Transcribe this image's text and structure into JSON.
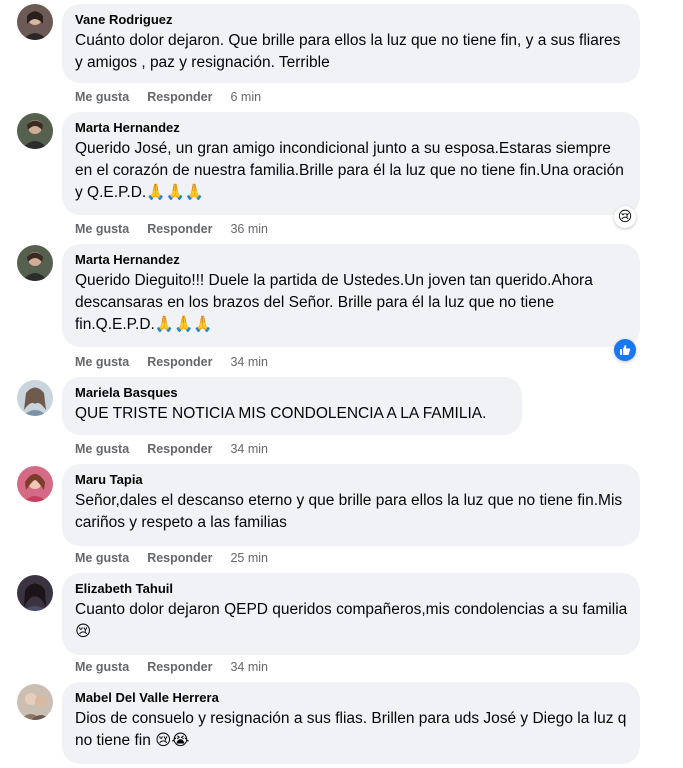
{
  "comments": [
    {
      "author": "Vane Rodriguez",
      "text": "Cuánto dolor dejaron. Que brille para ellos la luz que no tiene fin, y a sus fliares y amigos , paz y resignación. Terrible",
      "like": "Me gusta",
      "reply": "Responder",
      "time": "6 min",
      "avatar_color": "#4a3b3a"
    },
    {
      "author": "Marta Hernandez",
      "text": "Querido José, un gran amigo incondicional junto a su esposa.Estaras siempre en el corazón de nuestra familia.Brille para él la luz que no tiene fin.Una oración y Q.E.P.D.🙏🙏🙏",
      "like": "Me gusta",
      "reply": "Responder",
      "time": "36 min",
      "avatar_color": "#3d4a3f",
      "reaction_icon": "sad-reaction-icon",
      "reaction_glyph": "😢"
    },
    {
      "author": "Marta Hernandez",
      "text": "Querido Dieguito!!! Duele la partida de Ustedes.Un joven tan querido.Ahora descansaras en los brazos del Señor. Brille para él la luz que no tiene fin.Q.E.P.D.🙏🙏🙏",
      "like": "Me gusta",
      "reply": "Responder",
      "time": "34 min",
      "avatar_color": "#3d4a3f",
      "reaction_icon": "like-reaction-icon",
      "reaction_glyph": "👍"
    },
    {
      "author": "Mariela Basques",
      "text": "QUE TRISTE NOTICIA MIS CONDOLENCIA A LA FAMILIA.",
      "like": "Me gusta",
      "reply": "Responder",
      "time": "34 min",
      "avatar_color": "#a9b8c4"
    },
    {
      "author": "Maru Tapia",
      "text": "Señor,dales el descanso eterno y que brille para ellos la luz que no tiene fin.Mis cariños y respeto a las familias",
      "like": "Me gusta",
      "reply": "Responder",
      "time": "25 min",
      "avatar_color": "#c2536b"
    },
    {
      "author": "Elizabeth Tahuil",
      "text": "Cuanto dolor dejaron QEPD queridos compañeros,mis condolencias a su familia 😢",
      "like": "Me gusta",
      "reply": "Responder",
      "time": "34 min",
      "avatar_color": "#2e2a35"
    },
    {
      "author": "Mabel Del Valle Herrera",
      "text": "Dios de consuelo y resignación a sus flias. Brillen para uds José y Diego la luz q no tiene fin 😢😭",
      "like": "Me gusta",
      "reply": "Responder",
      "time": "",
      "avatar_color": "#b9a89a"
    }
  ]
}
